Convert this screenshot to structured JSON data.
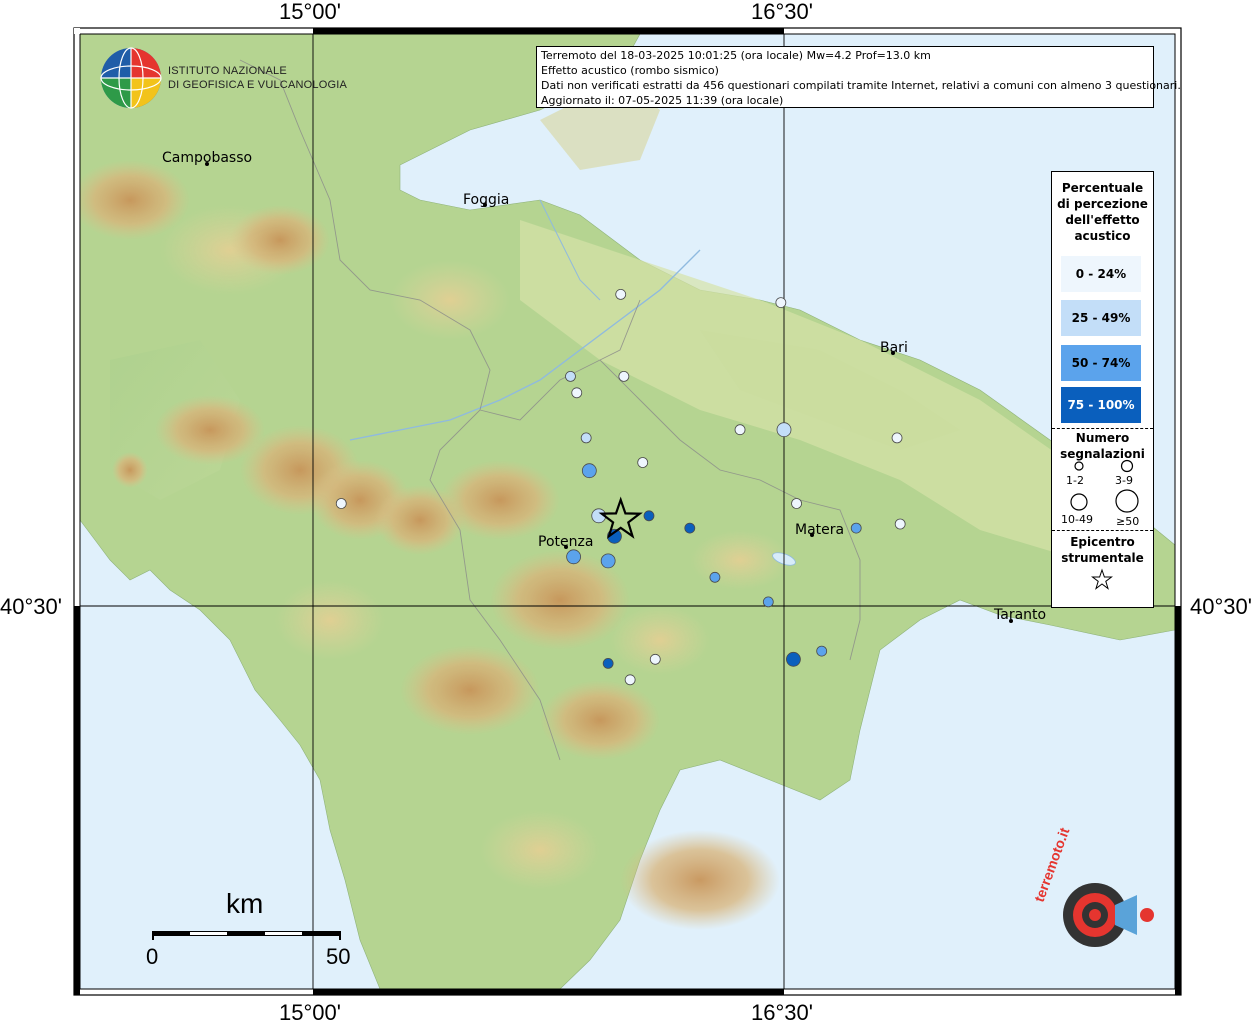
{
  "header": {
    "line1": "Terremoto del 18-03-2025 10:01:25 (ora locale) Mw=4.2 Prof=13.0 km",
    "line2": "Effetto acustico (rombo sismico)",
    "line3": "Dati non verificati estratti da 456 questionari compilati tramite Internet, relativi a comuni con almeno 3 questionari.",
    "line4": "Aggiornato il: 07-05-2025 11:39 (ora locale)"
  },
  "institute": {
    "line1": "ISTITUTO NAZIONALE",
    "line2": "DI GEOFISICA E VULCANOLOGIA"
  },
  "coords": {
    "lon1": "15°00'",
    "lon2": "16°30'",
    "lat": "40°30'"
  },
  "cities": {
    "campobasso": "Campobasso",
    "foggia": "Foggia",
    "bari": "Bari",
    "matera": "Matera",
    "taranto": "Taranto",
    "potenza": "Potenza"
  },
  "legend": {
    "title_lines": [
      "Percentuale",
      "di percezione",
      "dell'effetto",
      "acustico"
    ],
    "classes": [
      {
        "label": "0 - 24%",
        "color": "#eef6fd"
      },
      {
        "label": "25 - 49%",
        "color": "#c3def8"
      },
      {
        "label": "50 - 74%",
        "color": "#5ba3ec"
      },
      {
        "label": "75 - 100%",
        "color": "#0a5fbd"
      }
    ],
    "count_title_lines": [
      "Numero",
      "segnalazioni"
    ],
    "count_labels": [
      "1-2",
      "3-9",
      "10-49",
      "≥50"
    ],
    "epicenter_lines": [
      "Epicentro",
      "strumentale"
    ]
  },
  "scale": {
    "unit": "km",
    "min": "0",
    "max": "50"
  },
  "points": [
    {
      "cls": 0,
      "size": 1,
      "lon": 15.98,
      "lat": 41.26
    },
    {
      "cls": 0,
      "size": 1,
      "lon": 15.09,
      "lat": 40.75
    },
    {
      "cls": 0,
      "size": 1,
      "lon": 16.49,
      "lat": 41.24
    },
    {
      "cls": 1,
      "size": 1,
      "lon": 15.82,
      "lat": 41.06
    },
    {
      "cls": 0,
      "size": 1,
      "lon": 15.99,
      "lat": 41.06
    },
    {
      "cls": 0,
      "size": 1,
      "lon": 15.84,
      "lat": 41.02
    },
    {
      "cls": 1,
      "size": 1,
      "lon": 15.87,
      "lat": 40.91
    },
    {
      "cls": 2,
      "size": 2,
      "lon": 15.88,
      "lat": 40.83
    },
    {
      "cls": 0,
      "size": 1,
      "lon": 16.05,
      "lat": 40.85
    },
    {
      "cls": 3,
      "size": 2,
      "lon": 15.96,
      "lat": 40.67
    },
    {
      "cls": 3,
      "size": 1,
      "lon": 16.07,
      "lat": 40.72
    },
    {
      "cls": 2,
      "size": 2,
      "lon": 15.83,
      "lat": 40.62
    },
    {
      "cls": 2,
      "size": 2,
      "lon": 15.94,
      "lat": 40.61
    },
    {
      "cls": 3,
      "size": 1,
      "lon": 16.2,
      "lat": 40.69
    },
    {
      "cls": 2,
      "size": 1,
      "lon": 16.28,
      "lat": 40.57
    },
    {
      "cls": 0,
      "size": 1,
      "lon": 16.36,
      "lat": 40.93
    },
    {
      "cls": 1,
      "size": 2,
      "lon": 16.5,
      "lat": 40.93
    },
    {
      "cls": 0,
      "size": 1,
      "lon": 16.86,
      "lat": 40.91
    },
    {
      "cls": 0,
      "size": 1,
      "lon": 16.54,
      "lat": 40.75
    },
    {
      "cls": 2,
      "size": 1,
      "lon": 16.73,
      "lat": 40.69
    },
    {
      "cls": 0,
      "size": 1,
      "lon": 16.87,
      "lat": 40.7
    },
    {
      "cls": 2,
      "size": 1,
      "lon": 16.45,
      "lat": 40.51
    },
    {
      "cls": 2,
      "size": 1,
      "lon": 16.62,
      "lat": 40.39
    },
    {
      "cls": 3,
      "size": 2,
      "lon": 16.53,
      "lat": 40.37
    },
    {
      "cls": 3,
      "size": 1,
      "lon": 15.94,
      "lat": 40.36
    },
    {
      "cls": 0,
      "size": 1,
      "lon": 16.09,
      "lat": 40.37
    },
    {
      "cls": 0,
      "size": 1,
      "lon": 16.01,
      "lat": 40.32
    },
    {
      "cls": 1,
      "size": 2,
      "lon": 15.91,
      "lat": 40.72
    }
  ],
  "epicenter": {
    "lon": 15.98,
    "lat": 40.71
  }
}
